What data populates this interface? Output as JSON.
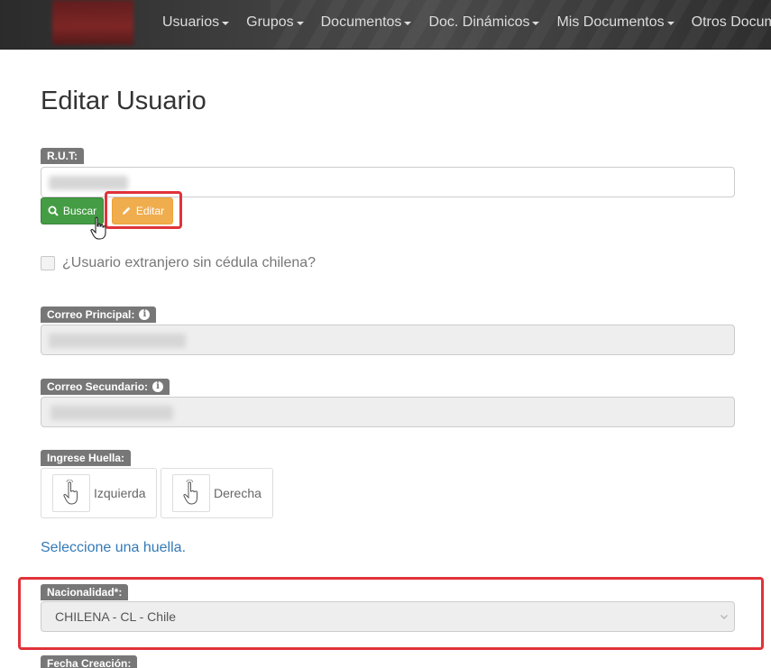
{
  "nav": {
    "items": [
      {
        "label": "Usuarios"
      },
      {
        "label": "Grupos"
      },
      {
        "label": "Documentos"
      },
      {
        "label": "Doc. Dinámicos"
      },
      {
        "label": "Mis Documentos"
      },
      {
        "label": "Otros Docum"
      }
    ]
  },
  "page": {
    "title": "Editar Usuario"
  },
  "rut": {
    "label": "R.U.T:",
    "buscar_label": "Buscar",
    "editar_label": "Editar"
  },
  "extranjero": {
    "label": "¿Usuario extranjero sin cédula chilena?",
    "checked": false
  },
  "correo_principal": {
    "label": "Correo Principal:"
  },
  "correo_secundario": {
    "label": "Correo Secundario:"
  },
  "huella": {
    "label": "Ingrese Huella:",
    "izquierda": "Izquierda",
    "derecha": "Derecha",
    "hint": "Seleccione una huella."
  },
  "nacionalidad": {
    "label": "Nacionalidad*:",
    "value": "CHILENA - CL - Chile"
  },
  "fecha_creacion": {
    "label": "Fecha Creación:"
  },
  "colors": {
    "highlight": "#e0333a",
    "buscar": "#449d44",
    "editar": "#f0ad4e",
    "badge": "#777777"
  }
}
